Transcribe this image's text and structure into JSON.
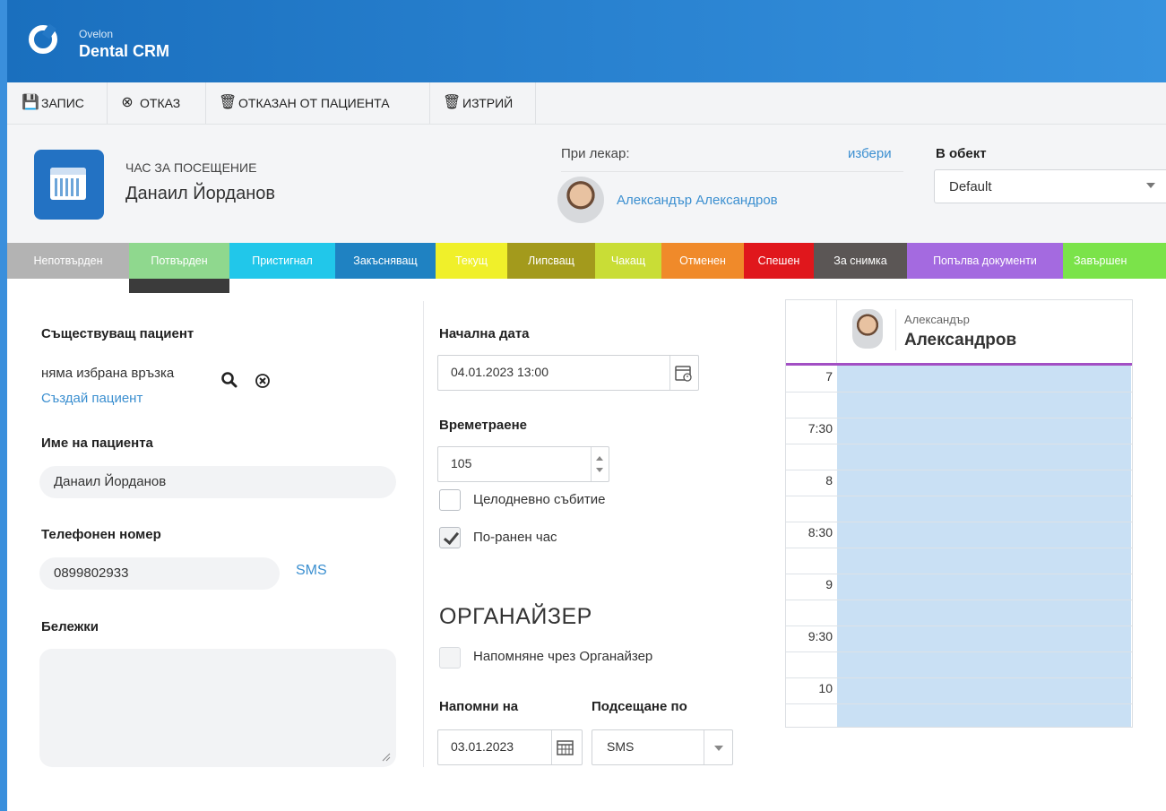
{
  "app": {
    "brand_small": "Ovelon",
    "brand_name": "Dental CRM"
  },
  "toolbar": [
    {
      "label": "ЗАПИС",
      "icon": "save-icon"
    },
    {
      "label": "ОТКАЗ",
      "icon": "cancel-circle-icon"
    },
    {
      "label": "ОТКАЗАН ОТ ПАЦИЕНТА",
      "icon": "trash-icon"
    },
    {
      "label": "ИЗТРИЙ",
      "icon": "trash-icon"
    }
  ],
  "header": {
    "kind": "ЧАС ЗА ПОСЕЩЕНИЕ",
    "patient": "Данаил Йорданов",
    "doctor_label": "При лекар:",
    "doctor_pick": "избери",
    "doctor_name": "Александър Александров",
    "object_label": "В обект",
    "object_value": "Default"
  },
  "statuses": [
    {
      "label": "Непотвърден",
      "bg": "#b3b3b3",
      "fg": "#ffffff"
    },
    {
      "label": "Потвърден",
      "bg": "#8fd88e",
      "fg": "#ffffff"
    },
    {
      "label": "Пристигнал",
      "bg": "#21c7ea",
      "fg": "#ffffff"
    },
    {
      "label": "Закъсняващ",
      "bg": "#1f82c2",
      "fg": "#ffffff"
    },
    {
      "label": "Текущ",
      "bg": "#f0f02a",
      "fg": "#ffffff"
    },
    {
      "label": "Липсващ",
      "bg": "#a39a1c",
      "fg": "#ffffff"
    },
    {
      "label": "Чакащ",
      "bg": "#c9dd36",
      "fg": "#ffffff"
    },
    {
      "label": "Отменен",
      "bg": "#f08a2a",
      "fg": "#ffffff"
    },
    {
      "label": "Спешен",
      "bg": "#e0171c",
      "fg": "#ffffff"
    },
    {
      "label": "За снимка",
      "bg": "#5b5655",
      "fg": "#ffffff"
    },
    {
      "label": "Попълва документи",
      "bg": "#a46ae0",
      "fg": "#ffffff"
    },
    {
      "label": "Завършен",
      "bg": "#7be34a",
      "fg": "#ffffff"
    }
  ],
  "selected_status": "Потвърден",
  "left": {
    "existing_label": "Съществуващ пациент",
    "no_link": "няма избрана връзка",
    "create_link": "Създай пациент",
    "name_label": "Име на пациента",
    "name_value": "Данаил Йорданов",
    "phone_label": "Телефонен номер",
    "phone_value": "0899802933",
    "sms_link": "SMS",
    "notes_label": "Бележки",
    "notes_value": ""
  },
  "middle": {
    "start_label": "Начална дата",
    "start_value": "04.01.2023 13:00",
    "duration_label": "Времетраене",
    "duration_value": "105",
    "allday_label": "Целодневно събитие",
    "allday_checked": false,
    "earlier_label": "По-ранен час",
    "earlier_checked": true,
    "organizer_title": "ОРГАНАЙЗЕР",
    "reminder_label": "Напомняне чрез Органайзер",
    "reminder_checked": false,
    "remind_on_label": "Напомни на",
    "remind_on_value": "03.01.2023",
    "remind_by_label": "Подсещане по",
    "remind_by_value": "SMS"
  },
  "calendar": {
    "doctor_first": "Александър",
    "doctor_last": "Александров",
    "times": [
      "7",
      "7:30",
      "8",
      "8:30",
      "9",
      "9:30",
      "10"
    ]
  }
}
